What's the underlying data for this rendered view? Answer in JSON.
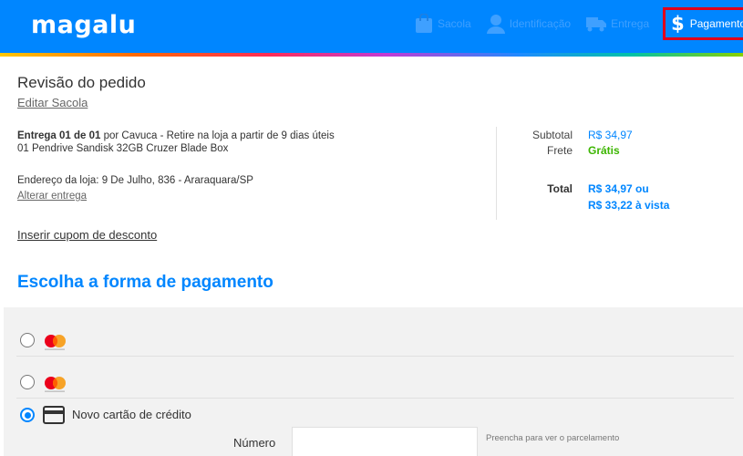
{
  "header": {
    "logo": "magalu",
    "steps": [
      {
        "label": "Sacola",
        "icon": "bag-icon"
      },
      {
        "label": "Identificação",
        "icon": "user-icon"
      },
      {
        "label": "Entrega",
        "icon": "truck-icon"
      },
      {
        "label": "Pagamento",
        "icon": "dollar-icon",
        "symbol": "$",
        "active": true
      }
    ]
  },
  "review": {
    "title": "Revisão do pedido",
    "edit_link": "Editar Sacola",
    "delivery_bold": "Entrega 01 de 01",
    "delivery_rest": " por Cavuca - Retire na loja a partir de 9 dias úteis",
    "product": "01 Pendrive Sandisk 32GB Cruzer Blade Box",
    "address": "Endereço da loja: 9 De Julho, 836 - Araraquara/SP",
    "alter_link": "Alterar entrega",
    "coupon_link": "Inserir cupom de desconto"
  },
  "summary": {
    "subtotal_label": "Subtotal",
    "subtotal_value": "R$ 34,97",
    "frete_label": "Frete",
    "frete_value": "Grátis",
    "total_label": "Total",
    "total_value_line1": "R$ 34,97 ou",
    "total_value_line2": "R$ 33,22 à vista"
  },
  "payment": {
    "title": "Escolha a forma de pagamento",
    "options": [
      {
        "type": "mastercard",
        "icon": "mastercard-icon",
        "selected": false
      },
      {
        "type": "mastercard",
        "icon": "mastercard-icon",
        "selected": false
      },
      {
        "type": "new-card",
        "icon": "credit-card-icon",
        "label": "Novo cartão de crédito",
        "selected": true
      }
    ],
    "number_label": "Número",
    "number_value": "",
    "hint": "Preencha para ver o parcelamento"
  },
  "colors": {
    "brand_blue": "#0086ff",
    "highlight_red": "#e0001b",
    "free_green": "#3cb500"
  }
}
